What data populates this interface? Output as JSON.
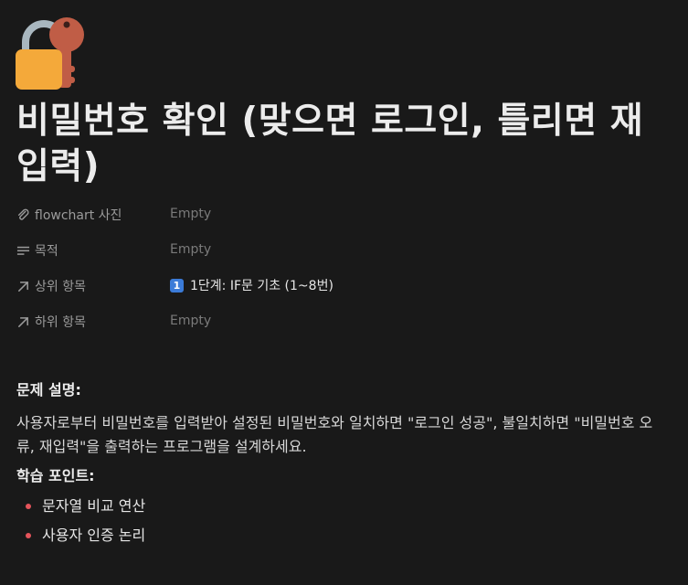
{
  "page": {
    "icon": "lock-with-key-icon",
    "title": "비밀번호 확인 (맞으면 로그인, 틀리면 재입력)"
  },
  "properties": [
    {
      "icon": "paperclip-icon",
      "label": "flowchart 사진",
      "value": "Empty"
    },
    {
      "icon": "text-lines-icon",
      "label": "목적",
      "value": "Empty"
    },
    {
      "icon": "arrow-up-right-icon",
      "label": "상위 항목",
      "badge": "1",
      "value": "1단계: IF문 기초 (1~8번)"
    },
    {
      "icon": "arrow-up-right-icon",
      "label": "하위 항목",
      "value": "Empty"
    }
  ],
  "content": {
    "problem_heading": "문제 설명:",
    "problem_text": "사용자로부터 비밀번호를 입력받아 설정된 비밀번호와 일치하면 \"로그인 성공\", 불일치하면 \"비밀번호 오류, 재입력\"을 출력하는 프로그램을 설계하세요.",
    "points_heading": "학습 포인트:",
    "points": [
      "문자열 비교 연산",
      "사용자 인증 논리"
    ]
  },
  "colors": {
    "background": "#191919",
    "bullet": "#e5545b",
    "badge": "#3b7bd8"
  }
}
